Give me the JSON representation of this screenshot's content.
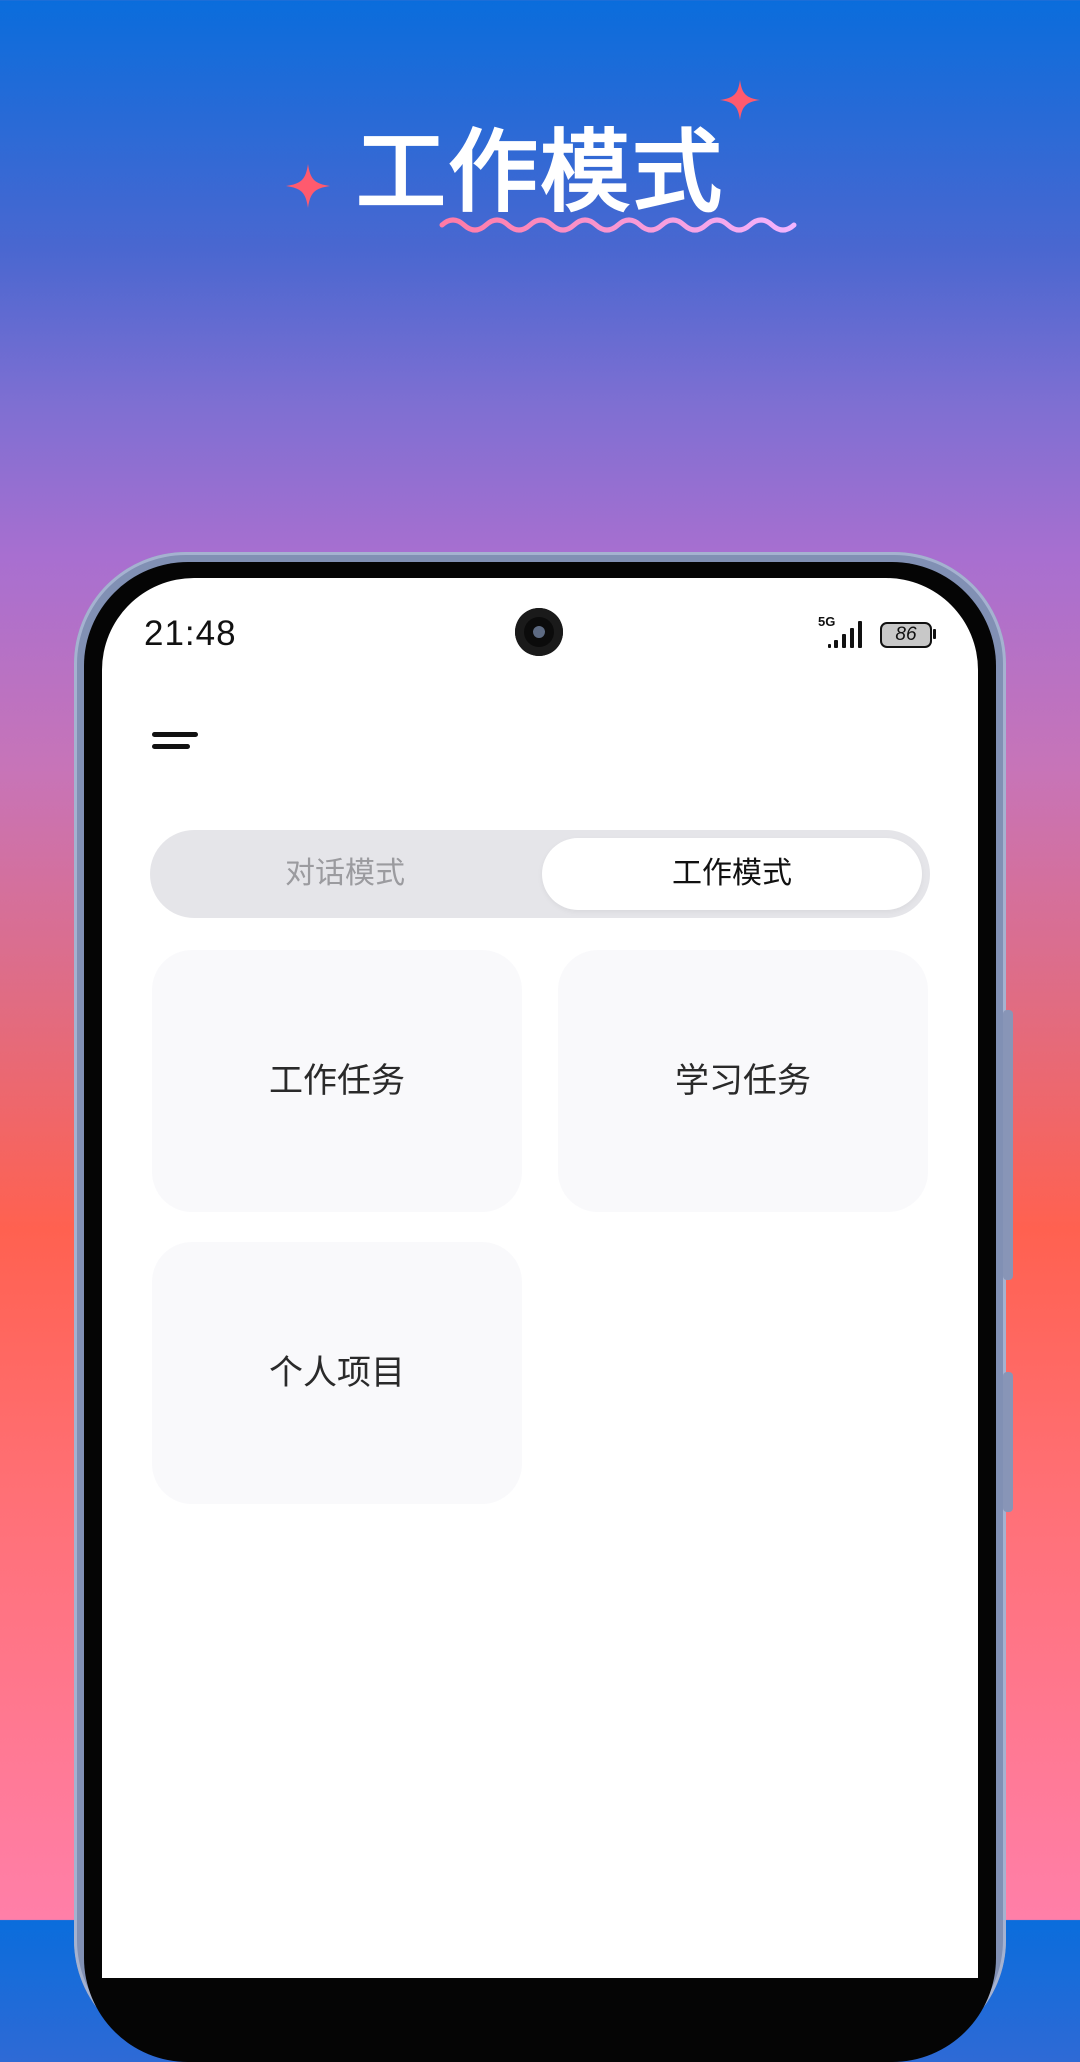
{
  "banner": {
    "title": "工作模式"
  },
  "colors": {
    "sparkle": "#ff5a6e",
    "squiggle_start": "#ff7aa5",
    "squiggle_end": "#f2b4ff"
  },
  "status_bar": {
    "time": "21:48",
    "network": "5G",
    "battery": "86"
  },
  "app": {
    "menu_icon": "menu-icon",
    "mode_tabs": [
      {
        "label": "对话模式",
        "selected": false
      },
      {
        "label": "工作模式",
        "selected": true
      }
    ],
    "cards": [
      {
        "label": "工作任务"
      },
      {
        "label": "学习任务"
      },
      {
        "label": "个人项目"
      }
    ]
  }
}
